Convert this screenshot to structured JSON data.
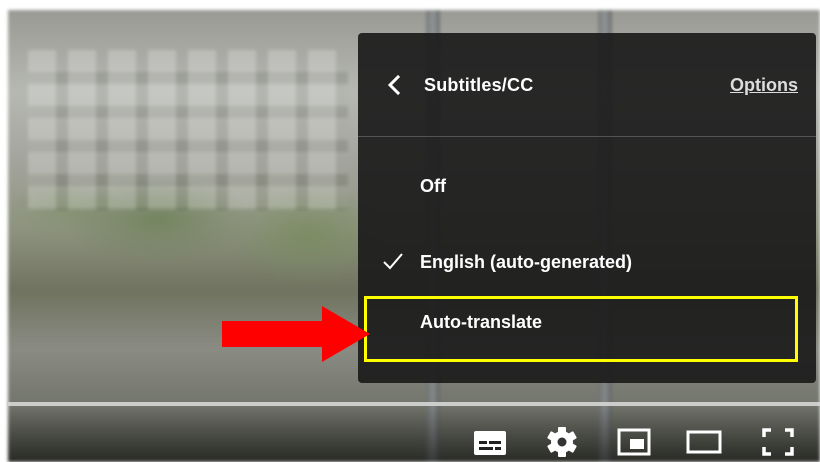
{
  "menu": {
    "title": "Subtitles/CC",
    "options_label": "Options",
    "items": [
      {
        "label": "Off",
        "checked": false
      },
      {
        "label": "English (auto-generated)",
        "checked": true
      },
      {
        "label": "Auto-translate",
        "checked": false
      }
    ]
  },
  "icons": {
    "back": "chevron-left-icon",
    "check": "checkmark-icon",
    "subtitles": "subtitles-icon",
    "settings": "gear-icon",
    "miniplayer": "miniplayer-icon",
    "theater": "theater-mode-icon",
    "fullscreen": "fullscreen-icon"
  },
  "colors": {
    "menu_bg": "#1c1c1c",
    "highlight": "#ffff00",
    "annotation_arrow": "#ff0000"
  }
}
